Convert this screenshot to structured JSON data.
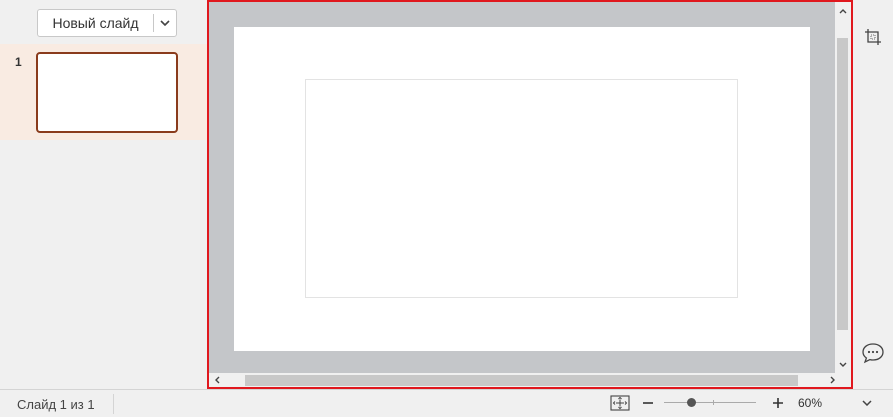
{
  "slides_panel": {
    "new_slide_label": "Новый слайд",
    "slides": [
      {
        "number": "1"
      }
    ]
  },
  "status": {
    "slide_info": "Слайд 1 из 1",
    "zoom": "60%"
  },
  "icons": {
    "dropdown": "chevron-down-icon",
    "fit": "fit-to-slide-icon",
    "crop": "crop-icon",
    "comment": "comment-icon"
  },
  "colors": {
    "selection_border": "#e0181e",
    "thumb_border": "#8a3b1c",
    "thumb_row_bg": "#f9ebe2",
    "workspace_bg": "#c4c6c9"
  }
}
